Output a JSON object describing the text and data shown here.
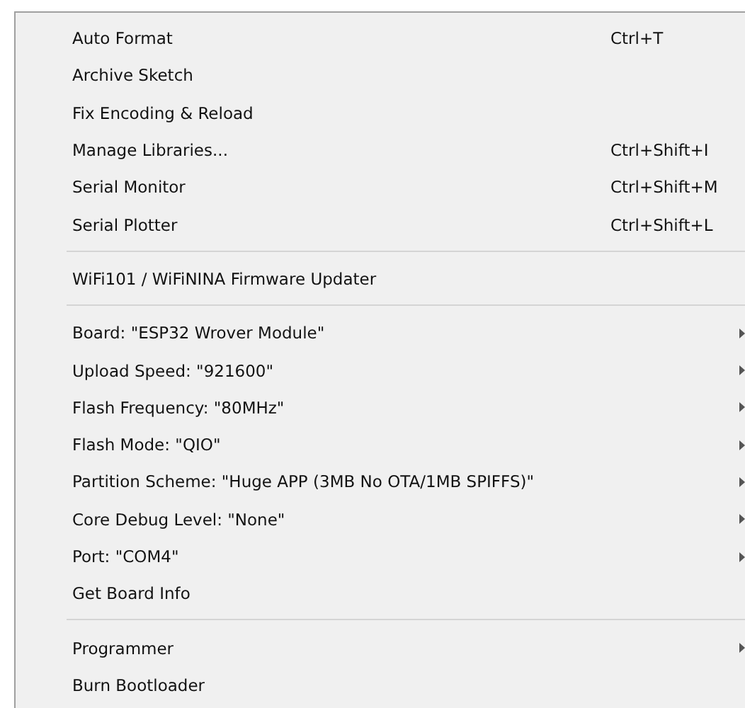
{
  "menu": {
    "groups": [
      {
        "items": [
          {
            "label": "Auto Format",
            "shortcut": "Ctrl+T",
            "submenu": false
          },
          {
            "label": "Archive Sketch",
            "submenu": false
          },
          {
            "label": "Fix Encoding & Reload",
            "submenu": false
          },
          {
            "label": "Manage Libraries...",
            "shortcut": "Ctrl+Shift+I",
            "submenu": false
          },
          {
            "label": "Serial Monitor",
            "shortcut": "Ctrl+Shift+M",
            "submenu": false
          },
          {
            "label": "Serial Plotter",
            "shortcut": "Ctrl+Shift+L",
            "submenu": false
          }
        ]
      },
      {
        "items": [
          {
            "label": "WiFi101 / WiFiNINA Firmware Updater",
            "submenu": false
          }
        ]
      },
      {
        "items": [
          {
            "label": "Board: \"ESP32 Wrover Module\"",
            "submenu": true
          },
          {
            "label": "Upload Speed: \"921600\"",
            "submenu": true
          },
          {
            "label": "Flash Frequency: \"80MHz\"",
            "submenu": true
          },
          {
            "label": "Flash Mode: \"QIO\"",
            "submenu": true
          },
          {
            "label": "Partition Scheme: \"Huge APP (3MB No OTA/1MB SPIFFS)\"",
            "submenu": true
          },
          {
            "label": "Core Debug Level: \"None\"",
            "submenu": true
          },
          {
            "label": "Port: \"COM4\"",
            "submenu": true
          },
          {
            "label": "Get Board Info",
            "submenu": false
          }
        ]
      },
      {
        "items": [
          {
            "label": "Programmer",
            "submenu": true
          },
          {
            "label": "Burn Bootloader",
            "submenu": false
          }
        ]
      }
    ]
  }
}
